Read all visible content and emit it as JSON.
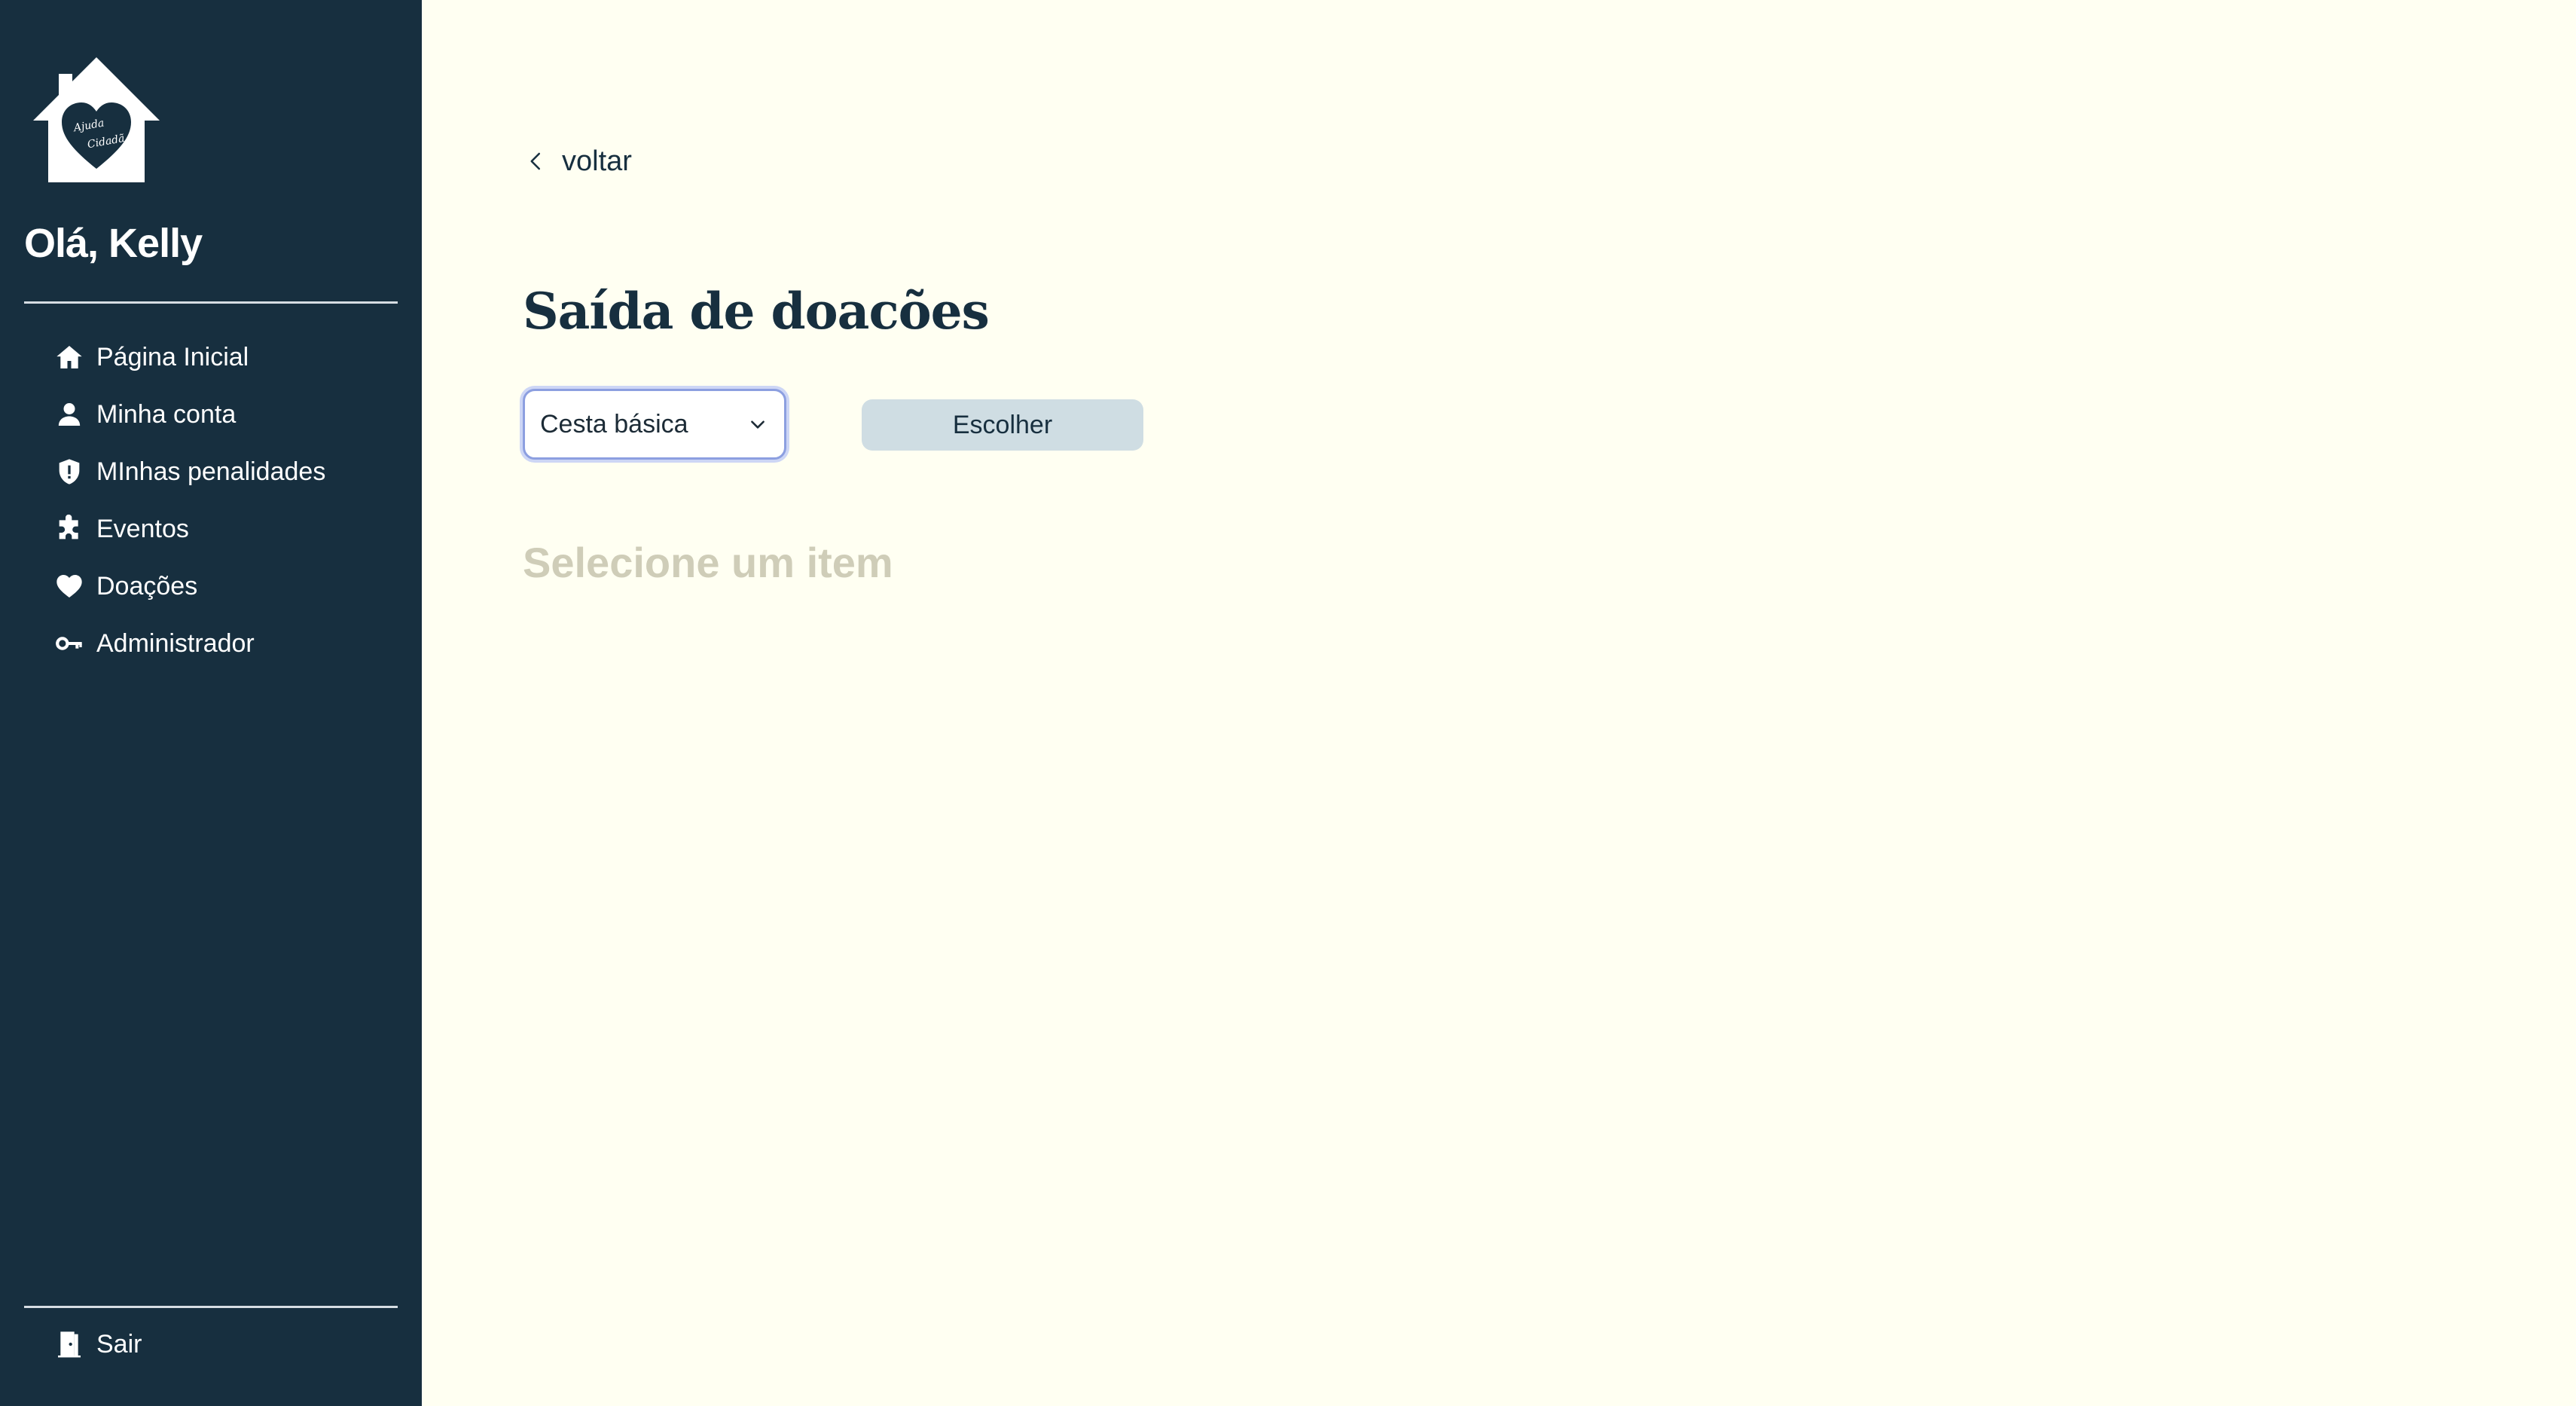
{
  "sidebar": {
    "greeting": "Olá, Kelly",
    "logo": {
      "icon": "house-heart-logo",
      "text": "Ajuda Cidadã"
    },
    "items": [
      {
        "label": "Página Inicial",
        "icon": "home-icon"
      },
      {
        "label": "Minha conta",
        "icon": "user-icon"
      },
      {
        "label": "MInhas penalidades",
        "icon": "shield-alert-icon"
      },
      {
        "label": "Eventos",
        "icon": "puzzle-icon"
      },
      {
        "label": "Doações",
        "icon": "heart-icon"
      },
      {
        "label": "Administrador",
        "icon": "key-icon"
      }
    ],
    "logout": {
      "label": "Sair",
      "icon": "door-exit-icon"
    }
  },
  "main": {
    "back_label": "voltar",
    "title": "Saída de doacões",
    "select": {
      "value": "Cesta básica"
    },
    "choose_label": "Escolher",
    "empty_message": "Selecione um item"
  },
  "colors": {
    "sidebar_bg": "#172f3f",
    "page_bg": "#fffff2",
    "button_bg": "#cfdde3",
    "muted_text": "#cfcdb8",
    "focus_ring": "#8c9fe0"
  }
}
